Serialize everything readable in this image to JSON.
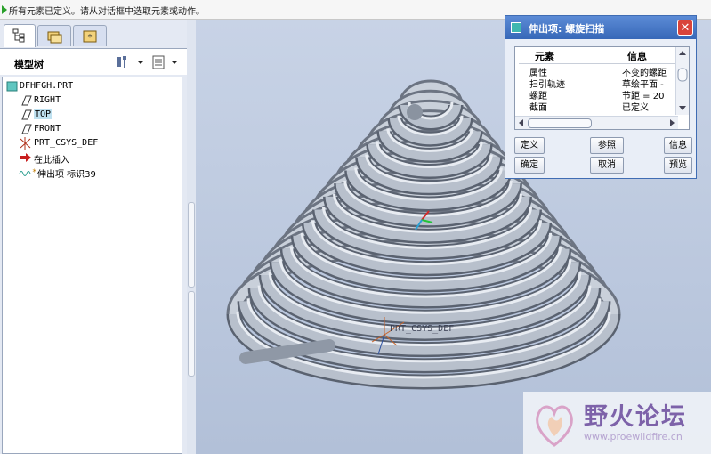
{
  "status_bar": {
    "message": "所有元素已定义。请从对话框中选取元素或动作。"
  },
  "left_panel": {
    "tabs": [
      {
        "icon": "model-tree-icon",
        "active": true
      },
      {
        "icon": "folder-browser-icon",
        "active": false
      },
      {
        "icon": "favorites-icon",
        "active": false
      }
    ],
    "model_tree_title": "模型树",
    "tree": [
      {
        "label": "DFHFGH.PRT",
        "icon": "part-icon"
      },
      {
        "label": "RIGHT",
        "icon": "datum-plane-icon"
      },
      {
        "label": "TOP",
        "icon": "datum-plane-icon",
        "highlighted": true
      },
      {
        "label": "FRONT",
        "icon": "datum-plane-icon"
      },
      {
        "label": "PRT_CSYS_DEF",
        "icon": "coordinate-system-icon"
      },
      {
        "label": "在此插入",
        "icon": "insert-here-arrow-icon"
      },
      {
        "label": "伸出项 标识39",
        "icon": "protrusion-feature-icon"
      }
    ]
  },
  "viewport": {
    "feature": "helical-sweep-spring",
    "csys_label": "PRT_CSYS_DEF"
  },
  "dialog": {
    "title": "伸出项: 螺旋扫描",
    "close_label": "✕",
    "table": {
      "headers": [
        "元素",
        "信息"
      ],
      "rows": [
        {
          "element": "属性",
          "info": "不变的螺距"
        },
        {
          "element": "扫引轨迹",
          "info": "草绘平面 -"
        },
        {
          "element": "螺距",
          "info": "节距 = 20"
        },
        {
          "element": "截面",
          "info": "已定义"
        }
      ]
    },
    "buttons": {
      "define": "定义",
      "reference": "参照",
      "info": "信息",
      "ok": "确定",
      "cancel": "取消",
      "preview": "预览"
    }
  },
  "watermark": {
    "title": "野火论坛",
    "url": "www.proewildfire.cn"
  },
  "colors": {
    "accent": "#3768b8",
    "status_ok": "#2aa02a",
    "viewport_bg": "#bcc8de",
    "spring": "#9aa4b2"
  }
}
